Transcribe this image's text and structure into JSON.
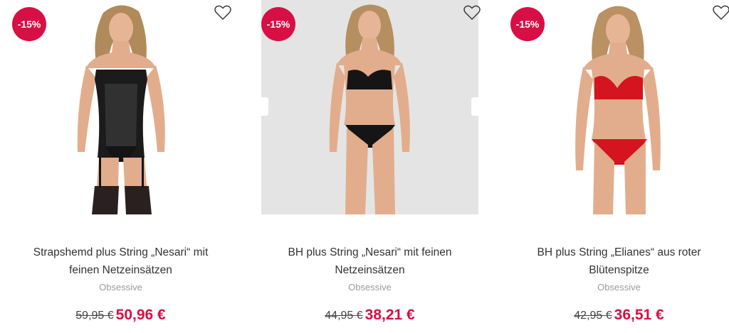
{
  "products": [
    {
      "discount": "-15%",
      "title_line1": "Strapshemd plus String „Nesari“ mit",
      "title_line2": "feinen Netzeinsätzen",
      "brand": "Obsessive",
      "old_price": "59,95 €",
      "new_price": "50,96 €",
      "image": "model-black-chemise"
    },
    {
      "discount": "-15%",
      "title_line1": "BH plus String „Nesari“ mit feinen",
      "title_line2": "Netzeinsätzen",
      "brand": "Obsessive",
      "old_price": "44,95 €",
      "new_price": "38,21 €",
      "image": "model-black-bra-set"
    },
    {
      "discount": "-15%",
      "title_line1": "BH plus String „Elianes“ aus roter",
      "title_line2": "Blütenspitze",
      "brand": "Obsessive",
      "old_price": "42,95 €",
      "new_price": "36,51 €",
      "image": "model-red-lace-set"
    }
  ],
  "colors": {
    "badge": "#d70f45",
    "sale_price": "#d70f45",
    "title": "#333333",
    "brand": "#9a9a9a",
    "image_bg_hover": "#e4e4e4"
  },
  "icons": {
    "wishlist": "heart-outline-icon"
  }
}
